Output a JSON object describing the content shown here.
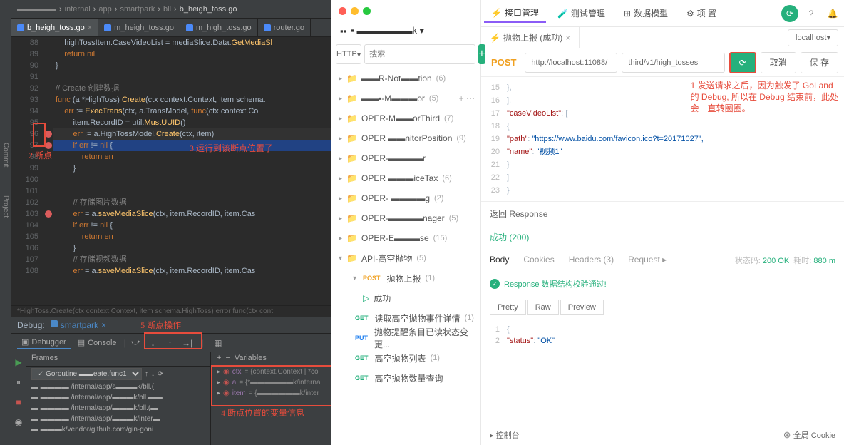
{
  "ide": {
    "breadcrumb": [
      "▬▬▬▬▬",
      "internal",
      "app",
      "smartpark",
      "bll",
      "b_heigh_toss.go"
    ],
    "tabs": [
      {
        "label": "b_heigh_toss.go",
        "active": true
      },
      {
        "label": "m_heigh_toss.go",
        "active": false
      },
      {
        "label": "m_high_toss.go",
        "active": false
      },
      {
        "label": "router.go",
        "active": false
      }
    ],
    "code_lines": [
      {
        "n": "88",
        "t": "    highTossItem.CaseVideoList = mediaSlice.Data.GetMediaSl"
      },
      {
        "n": "89",
        "t": "    return nil",
        "kw": true
      },
      {
        "n": "90",
        "t": "}"
      },
      {
        "n": "91",
        "t": ""
      },
      {
        "n": "92",
        "t": "// Create 创建数据",
        "cmt": true
      },
      {
        "n": "93",
        "t": "func (a *HighToss) Create(ctx context.Context, item schema."
      },
      {
        "n": "94",
        "t": "    err := ExecTrans(ctx, a.TransModel, func(ctx context.Co"
      },
      {
        "n": "95",
        "t": "        item.RecordID = util.MustUUID()"
      },
      {
        "n": "96",
        "t": "        err := a.HighTossModel.Create(ctx, item)",
        "bp": true,
        "hl": "dark"
      },
      {
        "n": "97",
        "t": "        if err != nil {",
        "bp": true,
        "hl": "blue"
      },
      {
        "n": "98",
        "t": "            return err"
      },
      {
        "n": "99",
        "t": "        }"
      },
      {
        "n": "100",
        "t": ""
      },
      {
        "n": "101",
        "t": ""
      },
      {
        "n": "102",
        "t": "        // 存储图片数据",
        "cmt": true
      },
      {
        "n": "103",
        "t": "        err = a.saveMediaSlice(ctx, item.RecordID, item.Cas",
        "bp2": true
      },
      {
        "n": "104",
        "t": "        if err != nil {"
      },
      {
        "n": "105",
        "t": "            return err"
      },
      {
        "n": "106",
        "t": "        }"
      },
      {
        "n": "107",
        "t": "        // 存储视频数据",
        "cmt": true
      },
      {
        "n": "108",
        "t": "        err = a.saveMediaSlice(ctx, item.RecordID, item.Cas"
      }
    ],
    "annotations": {
      "a2": "2 断点",
      "a3": "3 运行到该断点位置了",
      "a4": "4 断点位置的变量信息",
      "a5": "5 断点操作"
    },
    "debug": {
      "hint": "*HighToss.Create(ctx context.Context, item schema.HighToss) error     func(ctx cont",
      "title": "Debug:",
      "app": "smartpark",
      "tabs": {
        "debugger": "Debugger",
        "console": "Console"
      },
      "frames_label": "Frames",
      "vars_label": "Variables",
      "goroutine": "Goroutine ▬▬eate.func1",
      "frames": [
        "▬▬▬▬ /internal/app/s▬▬▬k/bll.(",
        "▬▬▬▬ /internal/app/▬▬▬k/bll.▬▬",
        "▬▬▬▬ /internal/app/▬▬▬k/bll.(▬",
        "▬▬▬▬ /internal/app/▬▬▬k/inter▬",
        "▬▬▬k/vendor/github.com/gin-goni"
      ],
      "vars": [
        {
          "name": "ctx",
          "val": "= {context.Context | *co"
        },
        {
          "name": "a",
          "val": "= {*▬▬▬▬▬▬k/interna"
        },
        {
          "name": "item",
          "val": "= {▬▬▬▬▬▬k/inter"
        }
      ]
    }
  },
  "api": {
    "workspace": "▪ ▬▬▬▬▬▬k ▾",
    "http_label": "HTTP",
    "search_placeholder": "搜索",
    "tree": [
      {
        "label": "▬▬R-Not▬▬tion",
        "count": "(6)"
      },
      {
        "label": "▬▬▪-M▬▬▬or",
        "count": "(5)",
        "add": true
      },
      {
        "label": "OPER-M▬▬orThird",
        "count": "(7)"
      },
      {
        "label": "OPER ▬▬nitorPosition",
        "count": "(9)"
      },
      {
        "label": "OPER-▬▬▬▬r",
        "count": ""
      },
      {
        "label": "OPER ▬▬▬iceTax",
        "count": "(6)"
      },
      {
        "label": "OPER- ▬▬▬▬g",
        "count": "(2)"
      },
      {
        "label": "OPER-▬▬▬▬nager",
        "count": "(5)"
      },
      {
        "label": "OPER-E▬▬▬se",
        "count": "(15)"
      },
      {
        "label": "API-高空抛物",
        "count": "(5)",
        "open": true
      }
    ],
    "subtree": [
      {
        "method": "POST",
        "label": "抛物上报",
        "count": "(1)",
        "open": true
      },
      {
        "method": "",
        "label": "成功",
        "sub": true
      },
      {
        "method": "GET",
        "label": "读取高空抛物事件详情",
        "count": "(1)"
      },
      {
        "method": "PUT",
        "label": "抛物提醒条目已读状态变更...",
        "count": ""
      },
      {
        "method": "GET",
        "label": "高空抛物列表",
        "count": "(1)"
      },
      {
        "method": "GET",
        "label": "高空抛物数量查询",
        "count": ""
      }
    ],
    "topnav": [
      {
        "icon": "⚡",
        "label": "接口管理",
        "active": true
      },
      {
        "icon": "🧪",
        "label": "测试管理"
      },
      {
        "icon": "⊞",
        "label": "数据模型"
      },
      {
        "icon": "⚙",
        "label": "项    置"
      }
    ],
    "tab": {
      "label": "抛物上报 (成功)"
    },
    "env": "localhost",
    "request": {
      "method": "POST",
      "url_base": "http://localhost:11088/",
      "url_path": "third/v1/high_tosses",
      "cancel": "取消",
      "save": "保 存"
    },
    "json": [
      {
        "n": "15",
        "t": "    },"
      },
      {
        "n": "16",
        "t": "    ],"
      },
      {
        "n": "17",
        "t": "    \"caseVideoList\": ["
      },
      {
        "n": "18",
        "t": "        {"
      },
      {
        "n": "19",
        "t": "            \"path\": \"https://www.baidu.com/favicon.ico?t=20171027\","
      },
      {
        "n": "20",
        "t": "            \"name\": \"视频1\""
      },
      {
        "n": "21",
        "t": "        }"
      },
      {
        "n": "22",
        "t": "    ]"
      },
      {
        "n": "23",
        "t": "}"
      }
    ],
    "annotation1": "1 发送请求之后，因为触发了 GoLand\n的 Debug, 所以在 Debug 结束前，此处\n会一直转圈圈。",
    "response": {
      "header": "返回 Response",
      "status": "成功 (200)",
      "tabs": [
        "Body",
        "Cookies",
        "Headers (3)",
        "Request ▸"
      ],
      "status_code_label": "状态码:",
      "status_code": "200 OK",
      "time_label": "耗时:",
      "time": "880 m",
      "valid": "Response 数据结构校验通过!",
      "toolbar": [
        "Pretty",
        "Raw",
        "Preview"
      ],
      "body": [
        {
          "n": "1",
          "t": "{"
        },
        {
          "n": "2",
          "t": "    \"status\": \"OK\""
        }
      ]
    },
    "footer": {
      "console": "控制台",
      "cookie": "全局 Cookie"
    }
  }
}
